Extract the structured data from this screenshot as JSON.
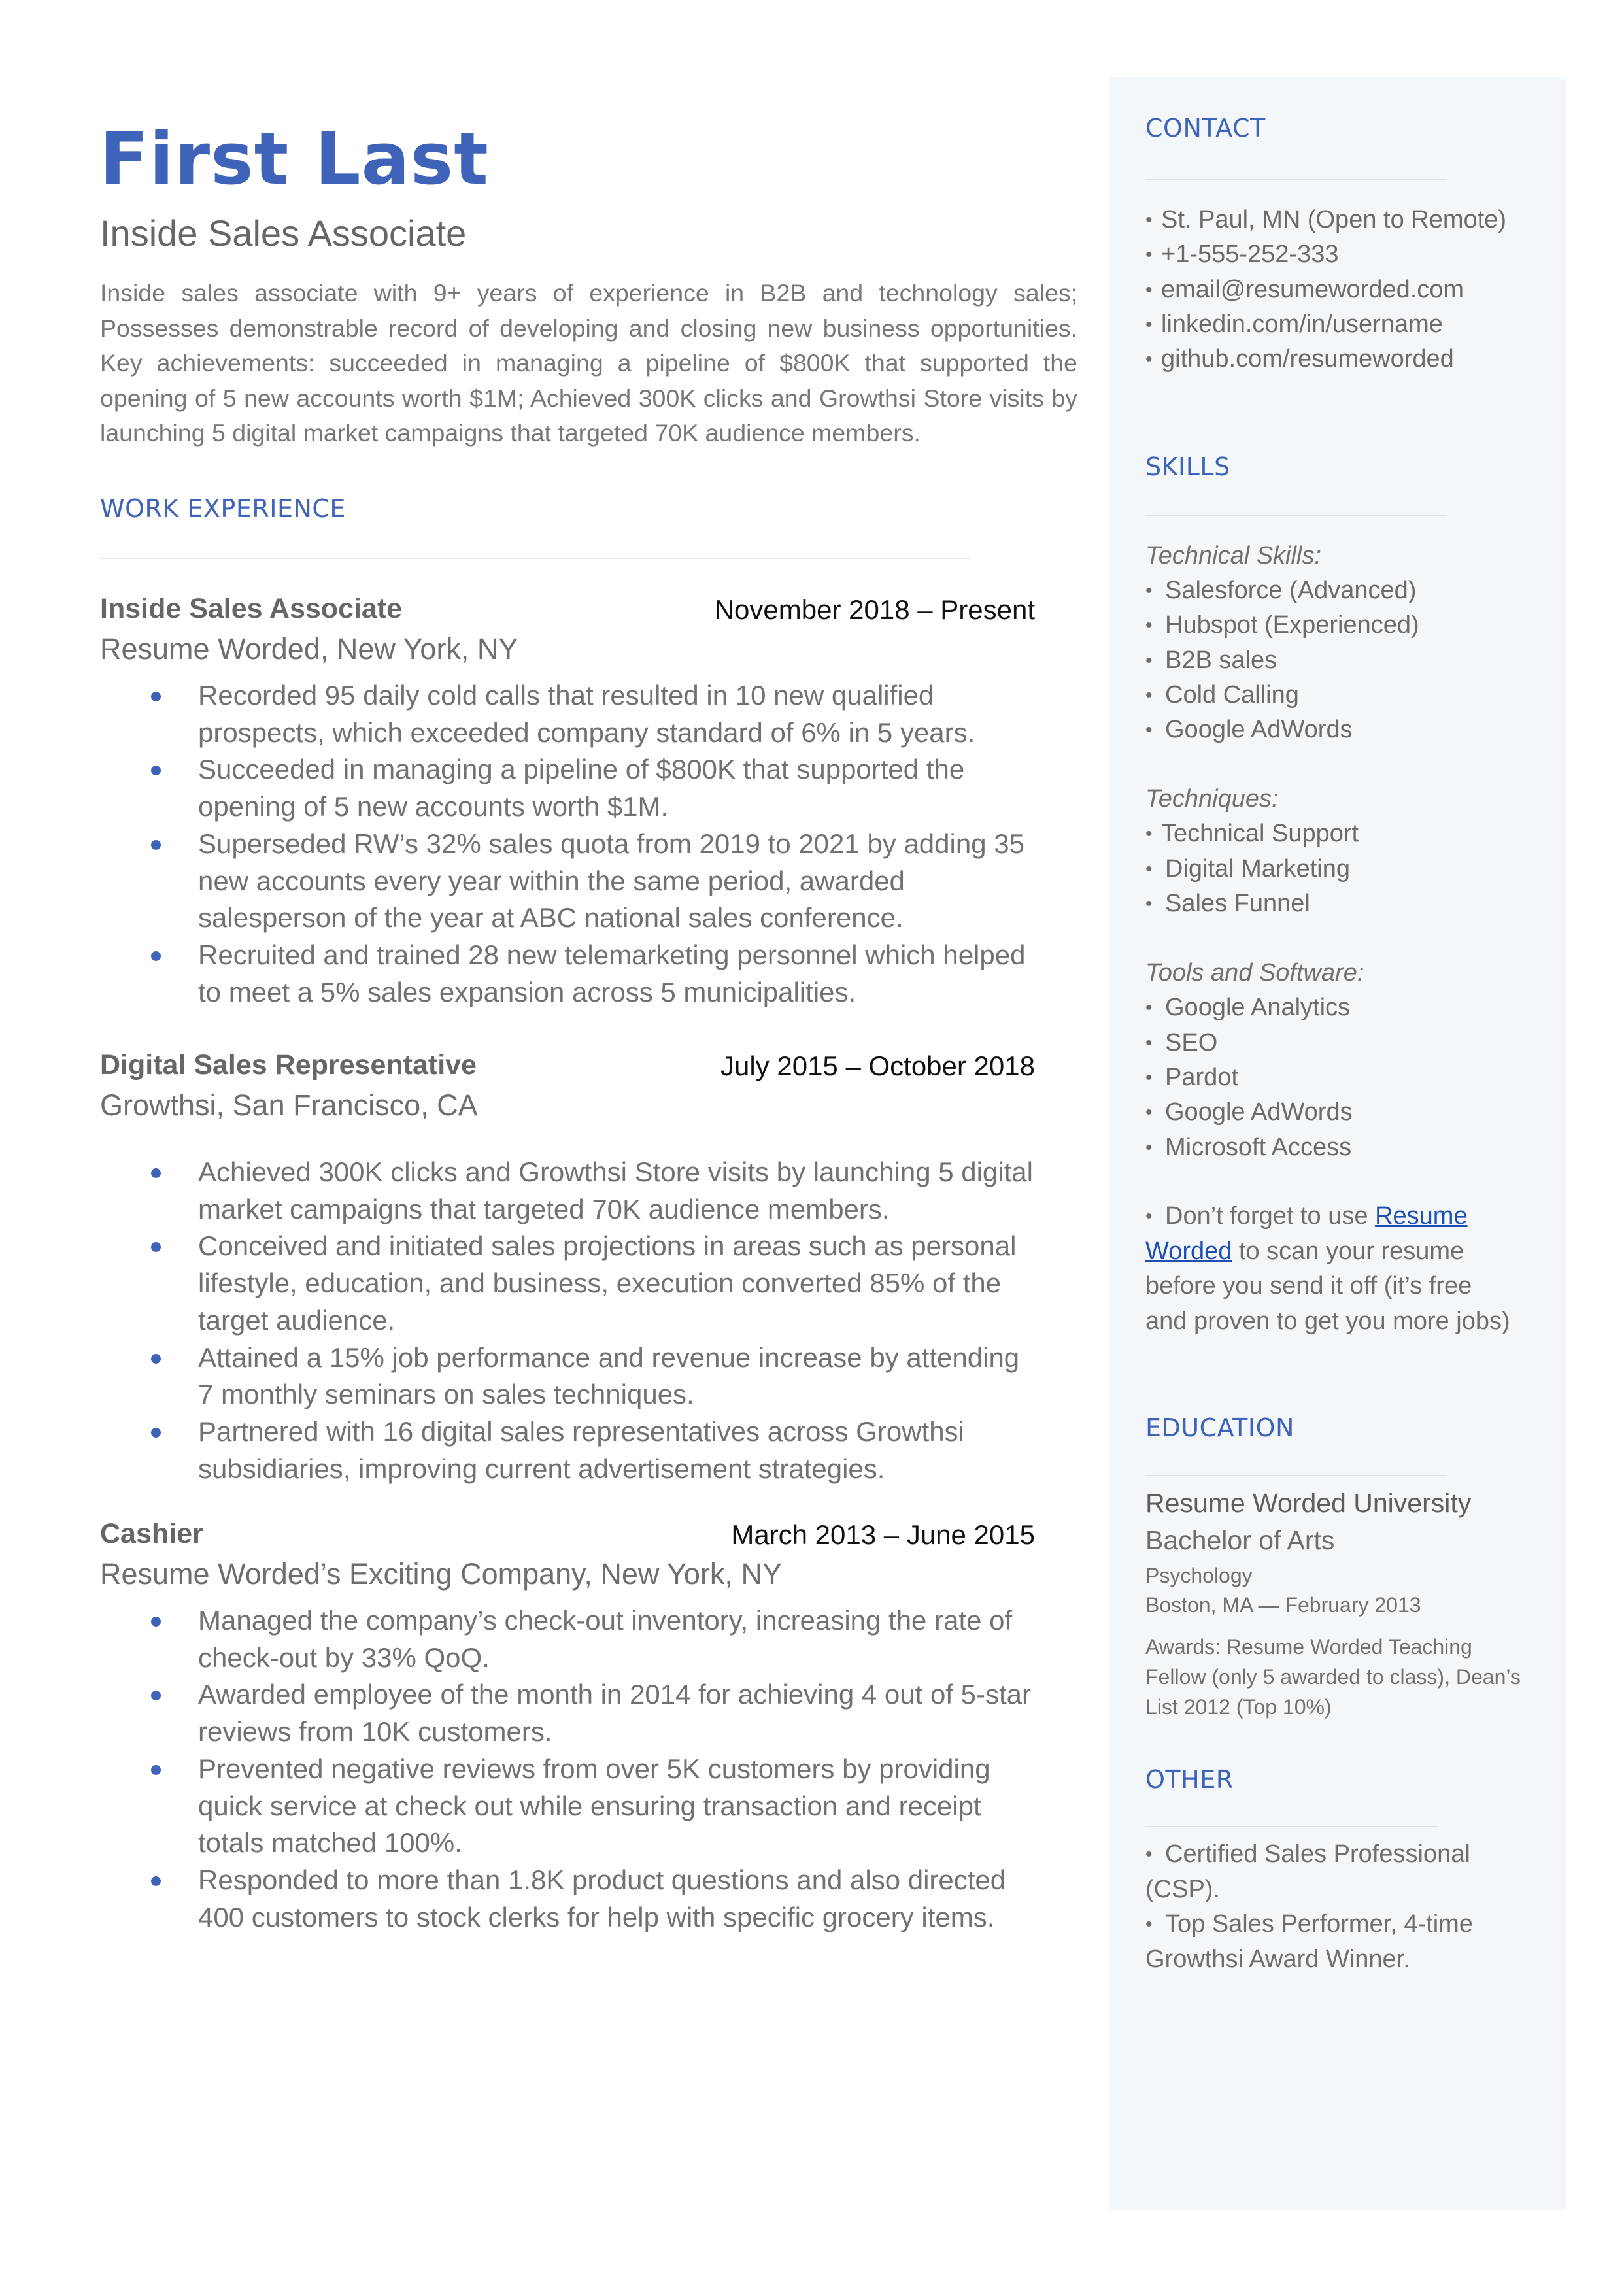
{
  "header": {
    "name": "First Last",
    "role": "Inside Sales Associate",
    "summary": "Inside sales associate with 9+ years of experience in B2B and technology sales; Possesses demonstrable record of developing and closing new business opportunities. Key achievements: succeeded in managing a pipeline of $800K that supported the opening of 5 new accounts worth $1M; Achieved 300K clicks and Growthsi Store visits by launching 5 digital market campaigns that targeted 70K audience members."
  },
  "colors": {
    "accent": "#3f63b8",
    "sidebar_bg": "#f4f7fa",
    "body_text": "#6b6b6b",
    "link": "#1f4fb3"
  },
  "work": {
    "title": "WORK EXPERIENCE",
    "jobs": [
      {
        "title": "Inside Sales Associate",
        "dates": "November 2018 – Present",
        "company": "Resume Worded, New York, NY",
        "bullets": [
          "Recorded 95 daily cold calls that resulted in 10 new qualified prospects, which exceeded company standard of 6% in 5 years.",
          "Succeeded in managing a pipeline of $800K that supported the opening of 5 new accounts worth $1M.",
          "Superseded RW’s 32% sales quota from 2019 to 2021 by adding 35 new accounts every year within the same period, awarded salesperson of the year at ABC national sales conference.",
          "Recruited and trained 28 new telemarketing personnel which helped to meet a 5% sales expansion across 5 municipalities."
        ]
      },
      {
        "title": "Digital Sales Representative",
        "dates": "July 2015 – October 2018",
        "company": "Growthsi, San Francisco, CA",
        "bullets": [
          "Achieved 300K clicks and Growthsi Store visits by launching 5 digital market campaigns that targeted 70K audience members.",
          "Conceived and initiated sales projections in areas such as personal lifestyle, education, and business, execution converted 85% of the target audience.",
          "Attained a 15% job performance and revenue increase by attending 7 monthly seminars on sales techniques.",
          "Partnered with 16 digital sales representatives across Growthsi subsidiaries, improving current advertisement strategies."
        ]
      },
      {
        "title": "Cashier",
        "dates": "March 2013 – June 2015",
        "company": "Resume Worded’s Exciting Company, New York, NY",
        "bullets": [
          "Managed the company’s check-out inventory, increasing the rate of check-out by 33% QoQ.",
          "Awarded employee of the month in 2014 for achieving 4 out of 5-star reviews from 10K customers.",
          "Prevented negative reviews from over 5K customers by providing quick service at check out while ensuring transaction and receipt totals matched 100%.",
          "Responded to more than 1.8K product questions and also directed 400 customers to stock clerks for help with specific grocery items."
        ]
      }
    ]
  },
  "sidebar": {
    "contact": {
      "title": "CONTACT",
      "items": [
        "St. Paul, MN (Open to Remote)",
        "+1-555-252-333",
        "email@resumeworded.com",
        "linkedin.com/in/username",
        "github.com/resumeworded"
      ]
    },
    "skills": {
      "title": "SKILLS",
      "categories": [
        {
          "label": "Technical Skills:",
          "items": [
            "Salesforce (Advanced)",
            "Hubspot (Experienced)",
            "B2B sales",
            "Cold Calling",
            "Google AdWords"
          ]
        },
        {
          "label": "Techniques:",
          "items": [
            "Technical Support",
            "Digital Marketing",
            "Sales Funnel"
          ]
        },
        {
          "label": "Tools and Software:",
          "items": [
            "Google Analytics",
            "SEO",
            "Pardot",
            "Google AdWords",
            "Microsoft Access"
          ]
        }
      ],
      "tip": {
        "prefix": "Don’t forget to use ",
        "link_text": "Resume Worded",
        "suffix": " to scan your resume before you send it off (it’s free and proven to get you more jobs)"
      }
    },
    "education": {
      "title": "EDUCATION",
      "school": "Resume Worded University",
      "degree": "Bachelor of Arts",
      "major": "Psychology",
      "location_date": "Boston, MA — February 2013",
      "awards": "Awards: Resume Worded Teaching Fellow (only 5 awarded to class), Dean’s List 2012 (Top 10%)"
    },
    "other": {
      "title": "OTHER",
      "items": [
        "Certified Sales Professional (CSP).",
        "Top Sales Performer, 4-time Growthsi Award Winner."
      ]
    }
  }
}
